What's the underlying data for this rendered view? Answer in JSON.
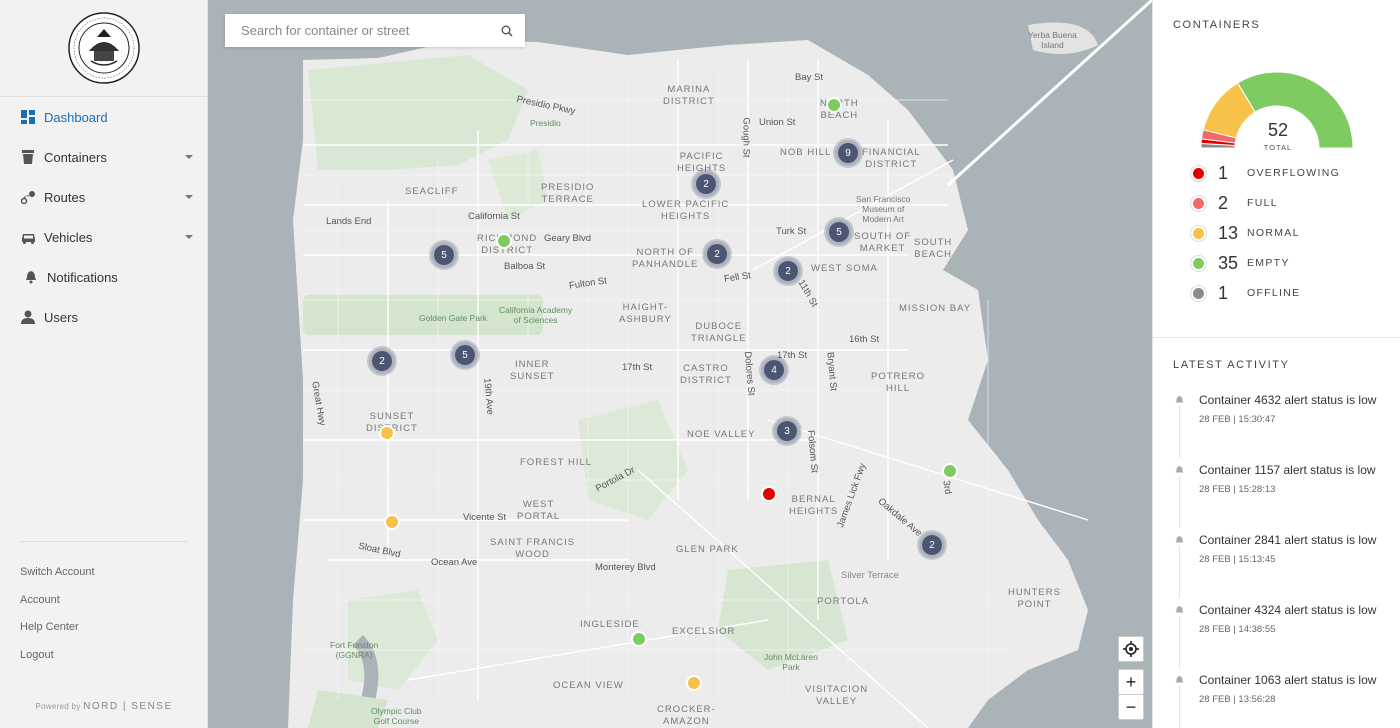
{
  "sidebar": {
    "logo_name": "Seal of the City and County of San Francisco",
    "nav": [
      {
        "label": "Dashboard",
        "icon": "dashboard-icon",
        "active": true,
        "has_caret": false
      },
      {
        "label": "Containers",
        "icon": "container-icon",
        "active": false,
        "has_caret": true
      },
      {
        "label": "Routes",
        "icon": "route-icon",
        "active": false,
        "has_caret": true
      },
      {
        "label": "Vehicles",
        "icon": "truck-icon",
        "active": false,
        "has_caret": true
      },
      {
        "label": "Notifications",
        "icon": "bell-icon",
        "active": false,
        "has_caret": false
      },
      {
        "label": "Users",
        "icon": "user-icon",
        "active": false,
        "has_caret": false
      }
    ],
    "links": [
      "Switch Account",
      "Account",
      "Help Center",
      "Logout"
    ],
    "powered_by": "Powered by",
    "brand": "NORD | SENSE"
  },
  "map": {
    "search_placeholder": "Search for container or street",
    "districts": [
      "MARINA\nDISTRICT",
      "NORTH\nBEACH",
      "NOB HILL",
      "FINANCIAL\nDISTRICT",
      "PACIFIC\nHEIGHTS",
      "SEACLIFF",
      "PRESIDIO\nTERRACE",
      "LOWER PACIFIC\nHEIGHTS",
      "RICHMOND\nDISTRICT",
      "NORTH OF\nPANHANDLE",
      "SOUTH OF\nMARKET",
      "SOUTH\nBEACH",
      "WEST SOMA",
      "HAIGHT-\nASHBURY",
      "MISSION BAY",
      "DUBOCE\nTRIANGLE",
      "INNER\nSUNSET",
      "CASTRO\nDISTRICT",
      "POTRERO\nHILL",
      "SUNSET\nDISTRICT",
      "NOE VALLEY",
      "FOREST HILL",
      "BERNAL\nHEIGHTS",
      "WEST\nPORTAL",
      "SAINT FRANCIS\nWOOD",
      "GLEN PARK",
      "PORTOLA",
      "HUNTERS\nPOINT",
      "INGLESIDE",
      "EXCELSIOR",
      "OCEAN VIEW",
      "VISITACION\nVALLEY",
      "CROCKER-\nAMAZON"
    ],
    "streets": [
      "Bay St",
      "Union St",
      "Presidio Pkwy",
      "Gough St",
      "California St",
      "Geary Blvd",
      "Turk St",
      "Balboa St",
      "Fulton St",
      "Fell St",
      "11th St",
      "Lands End",
      "16th St",
      "17th St",
      "17th St",
      "Dolores St",
      "Bryant St",
      "Great Hwy",
      "19th Ave",
      "Folsom St",
      "Portola Dr",
      "Vicente St",
      "Sloat Blvd",
      "Ocean Ave",
      "Monterey Blvd",
      "James Lick Fwy",
      "Oakdale Ave",
      "3rd",
      "Silver Terrace"
    ],
    "parks": [
      "Presidio",
      "Golden Gate Park",
      "California Academy\nof Sciences",
      "San Francisco\nMuseum of\nModern Art",
      "Yerba Buena\nIsland",
      "John McLaren\nPark",
      "Fort Funston\n(GGNRA)",
      "Olympic Club\nGolf Course"
    ],
    "clusters": [
      "9",
      "2",
      "5",
      "5",
      "2",
      "2",
      "2",
      "5",
      "4",
      "3",
      "2"
    ],
    "colors": {
      "overflowing": "#e00000",
      "full": "#f06a6a",
      "normal": "#f8c24a",
      "empty": "#7ecb62",
      "offline": "#8a8a8a",
      "cluster": "#4c5672"
    }
  },
  "panel": {
    "containers_title": "CONTAINERS",
    "total": "52",
    "total_label": "TOTAL",
    "legend": [
      {
        "count": "1",
        "label": "OVERFLOWING",
        "color": "#e00000"
      },
      {
        "count": "2",
        "label": "FULL",
        "color": "#f06a6a"
      },
      {
        "count": "13",
        "label": "NORMAL",
        "color": "#f8c24a"
      },
      {
        "count": "35",
        "label": "EMPTY",
        "color": "#7ecb62"
      },
      {
        "count": "1",
        "label": "OFFLINE",
        "color": "#8a8a8a"
      }
    ],
    "activity_title": "LATEST ACTIVITY",
    "activity": [
      {
        "text": "Container 4632 alert status is low",
        "time": "28 FEB | 15:30:47"
      },
      {
        "text": "Container 1157 alert status is low",
        "time": "28 FEB | 15:28:13"
      },
      {
        "text": "Container 2841 alert status is low",
        "time": "28 FEB | 15:13:45"
      },
      {
        "text": "Container 4324 alert status is low",
        "time": "28 FEB | 14:38:55"
      },
      {
        "text": "Container 1063 alert status is low",
        "time": "28 FEB | 13:56:28"
      }
    ]
  }
}
